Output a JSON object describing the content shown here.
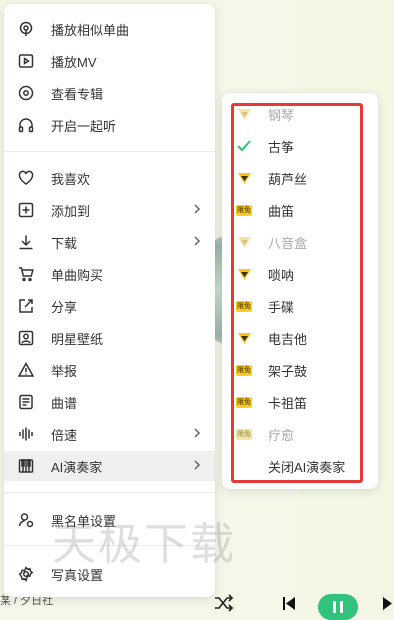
{
  "menu": {
    "items": [
      {
        "label": "播放相似单曲",
        "icon": "radar-icon"
      },
      {
        "label": "播放MV",
        "icon": "video-icon"
      },
      {
        "label": "查看专辑",
        "icon": "album-icon"
      },
      {
        "label": "开启一起听",
        "icon": "headphones-icon"
      },
      {
        "label": "我喜欢",
        "icon": "heart-icon"
      },
      {
        "label": "添加到",
        "icon": "add-icon"
      },
      {
        "label": "下载",
        "icon": "download-icon"
      },
      {
        "label": "单曲购买",
        "icon": "cart-icon"
      },
      {
        "label": "分享",
        "icon": "share-icon"
      },
      {
        "label": "明星壁纸",
        "icon": "portrait-icon"
      },
      {
        "label": "举报",
        "icon": "warning-icon"
      },
      {
        "label": "曲谱",
        "icon": "score-icon"
      },
      {
        "label": "倍速",
        "icon": "speed-icon"
      },
      {
        "label": "AI演奏家",
        "icon": "piano-icon"
      },
      {
        "label": "黑名单设置",
        "icon": "blacklist-icon"
      },
      {
        "label": "写真设置",
        "icon": "settings-icon"
      }
    ]
  },
  "submenu": {
    "items": [
      {
        "label": "钢琴",
        "badge": "vip-diamond",
        "dim": true
      },
      {
        "label": "古筝",
        "badge": "check",
        "dim": false
      },
      {
        "label": "葫芦丝",
        "badge": "vip-diamond",
        "dim": false
      },
      {
        "label": "曲笛",
        "badge": "vip-badge",
        "badge_text": "限免",
        "dim": false
      },
      {
        "label": "八音盒",
        "badge": "vip-diamond",
        "dim": true
      },
      {
        "label": "唢呐",
        "badge": "vip-diamond",
        "dim": false
      },
      {
        "label": "手碟",
        "badge": "vip-badge",
        "badge_text": "限免",
        "dim": false
      },
      {
        "label": "电吉他",
        "badge": "vip-diamond",
        "dim": false
      },
      {
        "label": "架子鼓",
        "badge": "vip-badge",
        "badge_text": "限免",
        "dim": false
      },
      {
        "label": "卡祖笛",
        "badge": "vip-badge",
        "badge_text": "限免",
        "dim": false
      },
      {
        "label": "疗愈",
        "badge": "vip-badge",
        "badge_text": "限免",
        "dim": true
      },
      {
        "label": "关闭AI演奏家",
        "badge": "none",
        "dim": false
      }
    ]
  },
  "footer": {
    "text": "某 / 夕日社"
  },
  "watermark": "天极下载",
  "colors": {
    "accent": "#31c27c",
    "highlight_box": "#e53935",
    "vip": "#f7d21c"
  }
}
